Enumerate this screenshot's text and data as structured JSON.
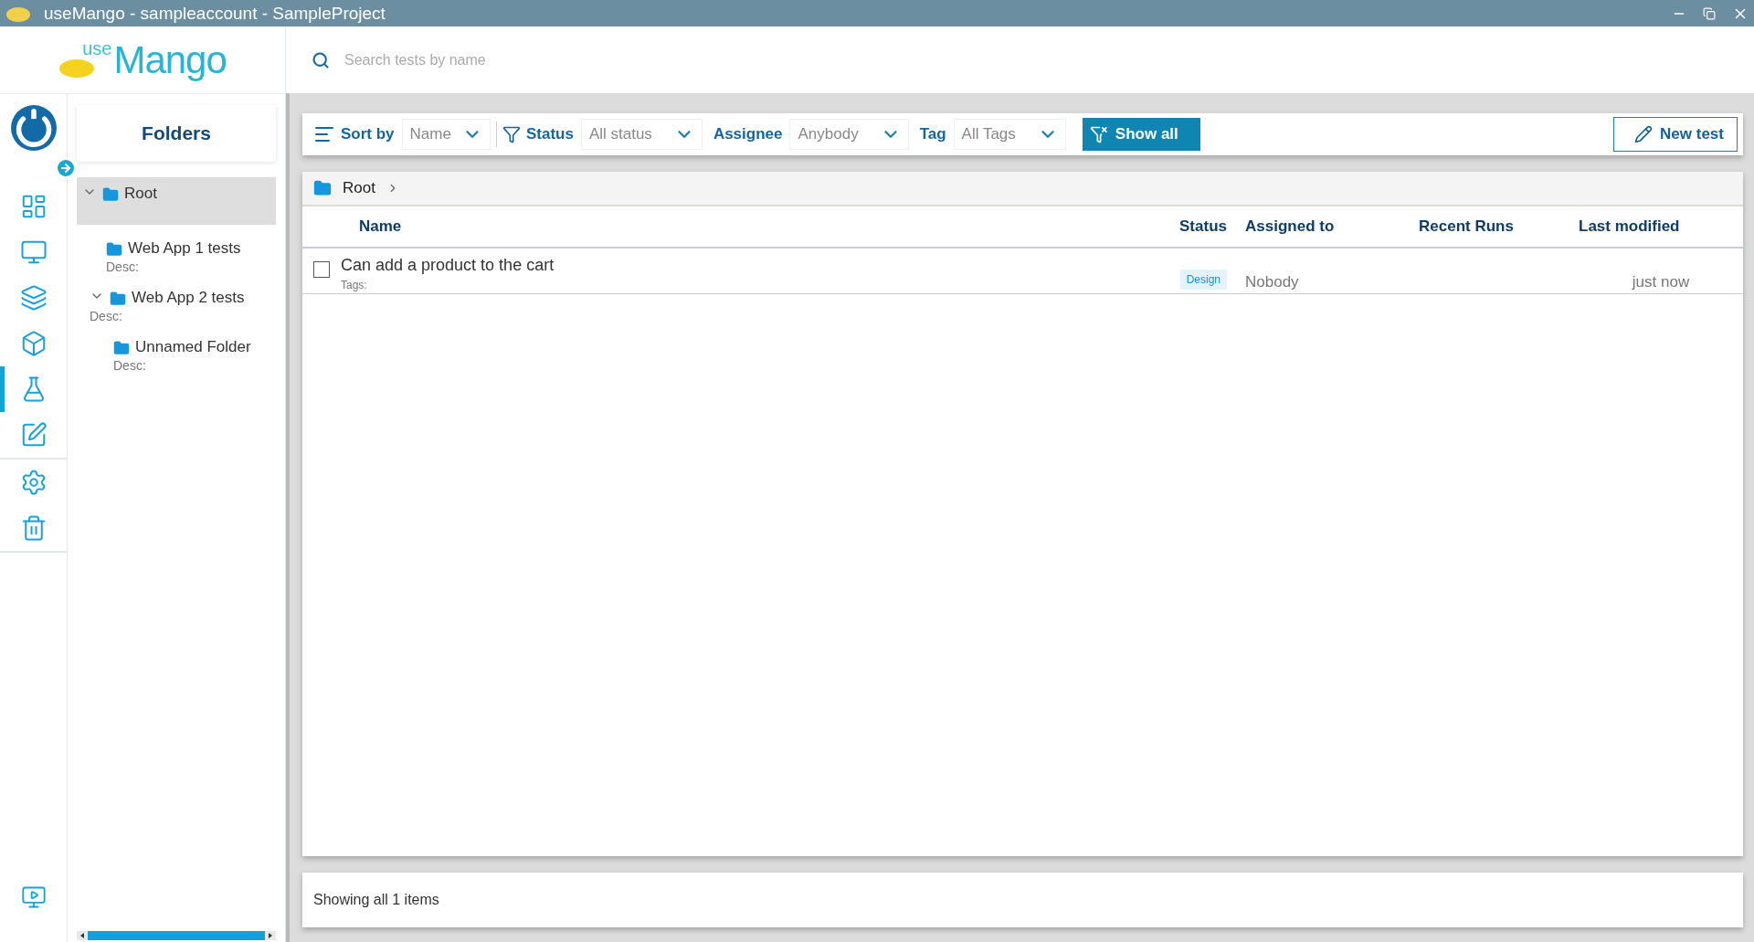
{
  "window": {
    "title": "useMango - sampleaccount - SampleProject"
  },
  "logo": {
    "prefix": "use",
    "name": "Mango"
  },
  "search": {
    "placeholder": "Search tests by name"
  },
  "nav": [
    {
      "kind": "dashboard",
      "selected": false
    },
    {
      "kind": "monitor",
      "selected": false
    },
    {
      "kind": "layers",
      "selected": false
    },
    {
      "kind": "box",
      "selected": false
    },
    {
      "kind": "flask",
      "selected": true
    },
    {
      "kind": "edit",
      "selected": false
    },
    {
      "kind": "settings",
      "selected": false
    },
    {
      "kind": "trash",
      "selected": false
    }
  ],
  "folders": {
    "title": "Folders",
    "tree": [
      {
        "name": "Root",
        "selected": true,
        "expanded": true,
        "children": [
          {
            "name": "Web App 1 tests",
            "desc": "Desc:",
            "selected": false
          },
          {
            "name": "Web App 2 tests",
            "desc": "Desc:",
            "selected": false,
            "expanded": true,
            "children": [
              {
                "name": "Unnamed Folder",
                "desc": "Desc:",
                "selected": false
              }
            ]
          }
        ]
      }
    ]
  },
  "toolbar": {
    "sort_label": "Sort by",
    "sort_value": "Name",
    "status_label": "Status",
    "status_value": "All status",
    "assignee_label": "Assignee",
    "assignee_value": "Anybody",
    "tag_label": "Tag",
    "tag_value": "All Tags",
    "show_all": "Show all",
    "new_test": "New test"
  },
  "breadcrumb": [
    "Root"
  ],
  "table": {
    "columns": [
      "Name",
      "Status",
      "Assigned to",
      "Recent Runs",
      "Last modified"
    ],
    "rows": [
      {
        "checked": false,
        "name": "Can add a product to the cart",
        "tags": "Tags:",
        "status": "Design",
        "assigned": "Nobody",
        "modified": "just now"
      }
    ]
  },
  "status_bar": "Showing all 1 items"
}
